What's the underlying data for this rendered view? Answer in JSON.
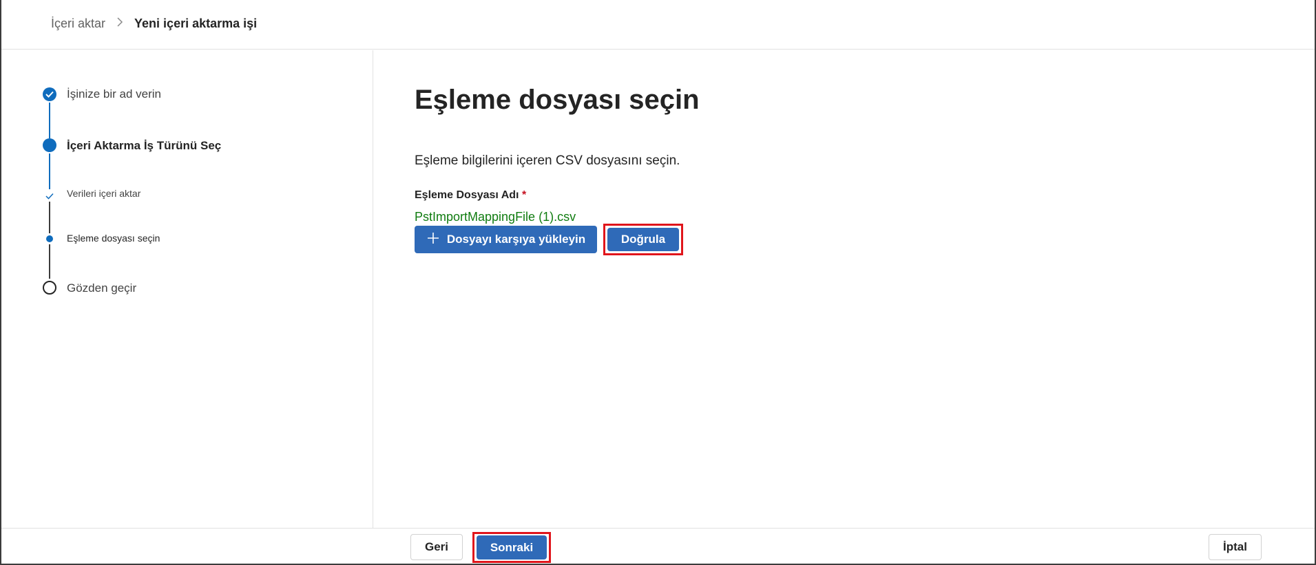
{
  "breadcrumb": {
    "parent": "İçeri aktar",
    "separator": ">",
    "current": "Yeni içeri aktarma işi"
  },
  "steps": [
    {
      "label": "İşinize bir ad verin",
      "state": "completed"
    },
    {
      "label": "İçeri Aktarma İş Türünü Seç",
      "state": "current"
    },
    {
      "label": "Verileri içeri aktar",
      "state": "completed-substep"
    },
    {
      "label": "Eşleme dosyası seçin",
      "state": "current-substep"
    },
    {
      "label": "Gözden geçir",
      "state": "pending"
    }
  ],
  "main": {
    "title": "Eşleme dosyası seçin",
    "description": "Eşleme bilgilerini içeren CSV dosyasını seçin.",
    "field_label": "Eşleme Dosyası Adı",
    "required_marker": "*",
    "file_name": "PstImportMappingFile (1).csv",
    "upload_label": "Dosyayı karşıya yükleyin",
    "validate_label": "Doğrula"
  },
  "footer": {
    "back_label": "Geri",
    "next_label": "Sonraki",
    "cancel_label": "İptal"
  },
  "colors": {
    "accent": "#0f6cbd",
    "button_primary": "#2f6ab8",
    "success_text": "#107c10",
    "highlight": "#e0151b",
    "required": "#c50f1f"
  }
}
